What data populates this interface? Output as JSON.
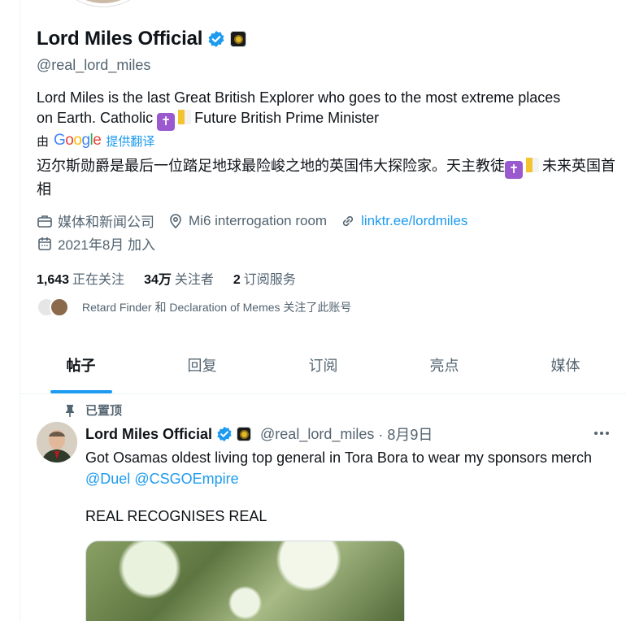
{
  "profile": {
    "display_name": "Lord Miles Official",
    "handle": "@real_lord_miles",
    "bio_line1": "Lord Miles is the last Great British Explorer who goes to the most extreme places",
    "bio_line2_a": "on Earth. Catholic",
    "bio_line2_b": "Future British Prime Minister",
    "translate_by": "由",
    "translate_provider": "Google",
    "translate_link": "提供翻译",
    "bio_zh_a": "迈尔斯勋爵是最后一位踏足地球最险峻之地的英国伟大探险家。天主教徒",
    "bio_zh_b": "未来英国首相",
    "category": "媒体和新闻公司",
    "location": "Mi6 interrogation room",
    "website": "linktr.ee/lordmiles",
    "joined": "2021年8月 加入"
  },
  "stats": {
    "following_count": "1,643",
    "following_label": "正在关注",
    "followers_count": "34万",
    "followers_label": "关注者",
    "subs_count": "2",
    "subs_label": "订阅服务"
  },
  "followed_by": "Retard Finder 和 Declaration of Memes 关注了此账号",
  "tabs": [
    {
      "label": "帖子",
      "active": true
    },
    {
      "label": "回复",
      "active": false
    },
    {
      "label": "订阅",
      "active": false
    },
    {
      "label": "亮点",
      "active": false
    },
    {
      "label": "媒体",
      "active": false
    }
  ],
  "post": {
    "pinned_label": "已置顶",
    "author_name": "Lord Miles Official",
    "author_handle": "@real_lord_miles",
    "time": "· 8月9日",
    "text_a": "Got Osamas oldest living top general in Tora Bora to wear my sponsors merch",
    "mention1": "@Duel",
    "mention2": "@CSGOEmpire",
    "text_b": "REAL RECOGNISES REAL"
  },
  "colors": {
    "accent": "#1d9bf0",
    "secondary_text": "#536471",
    "primary_text": "#0f1419"
  }
}
